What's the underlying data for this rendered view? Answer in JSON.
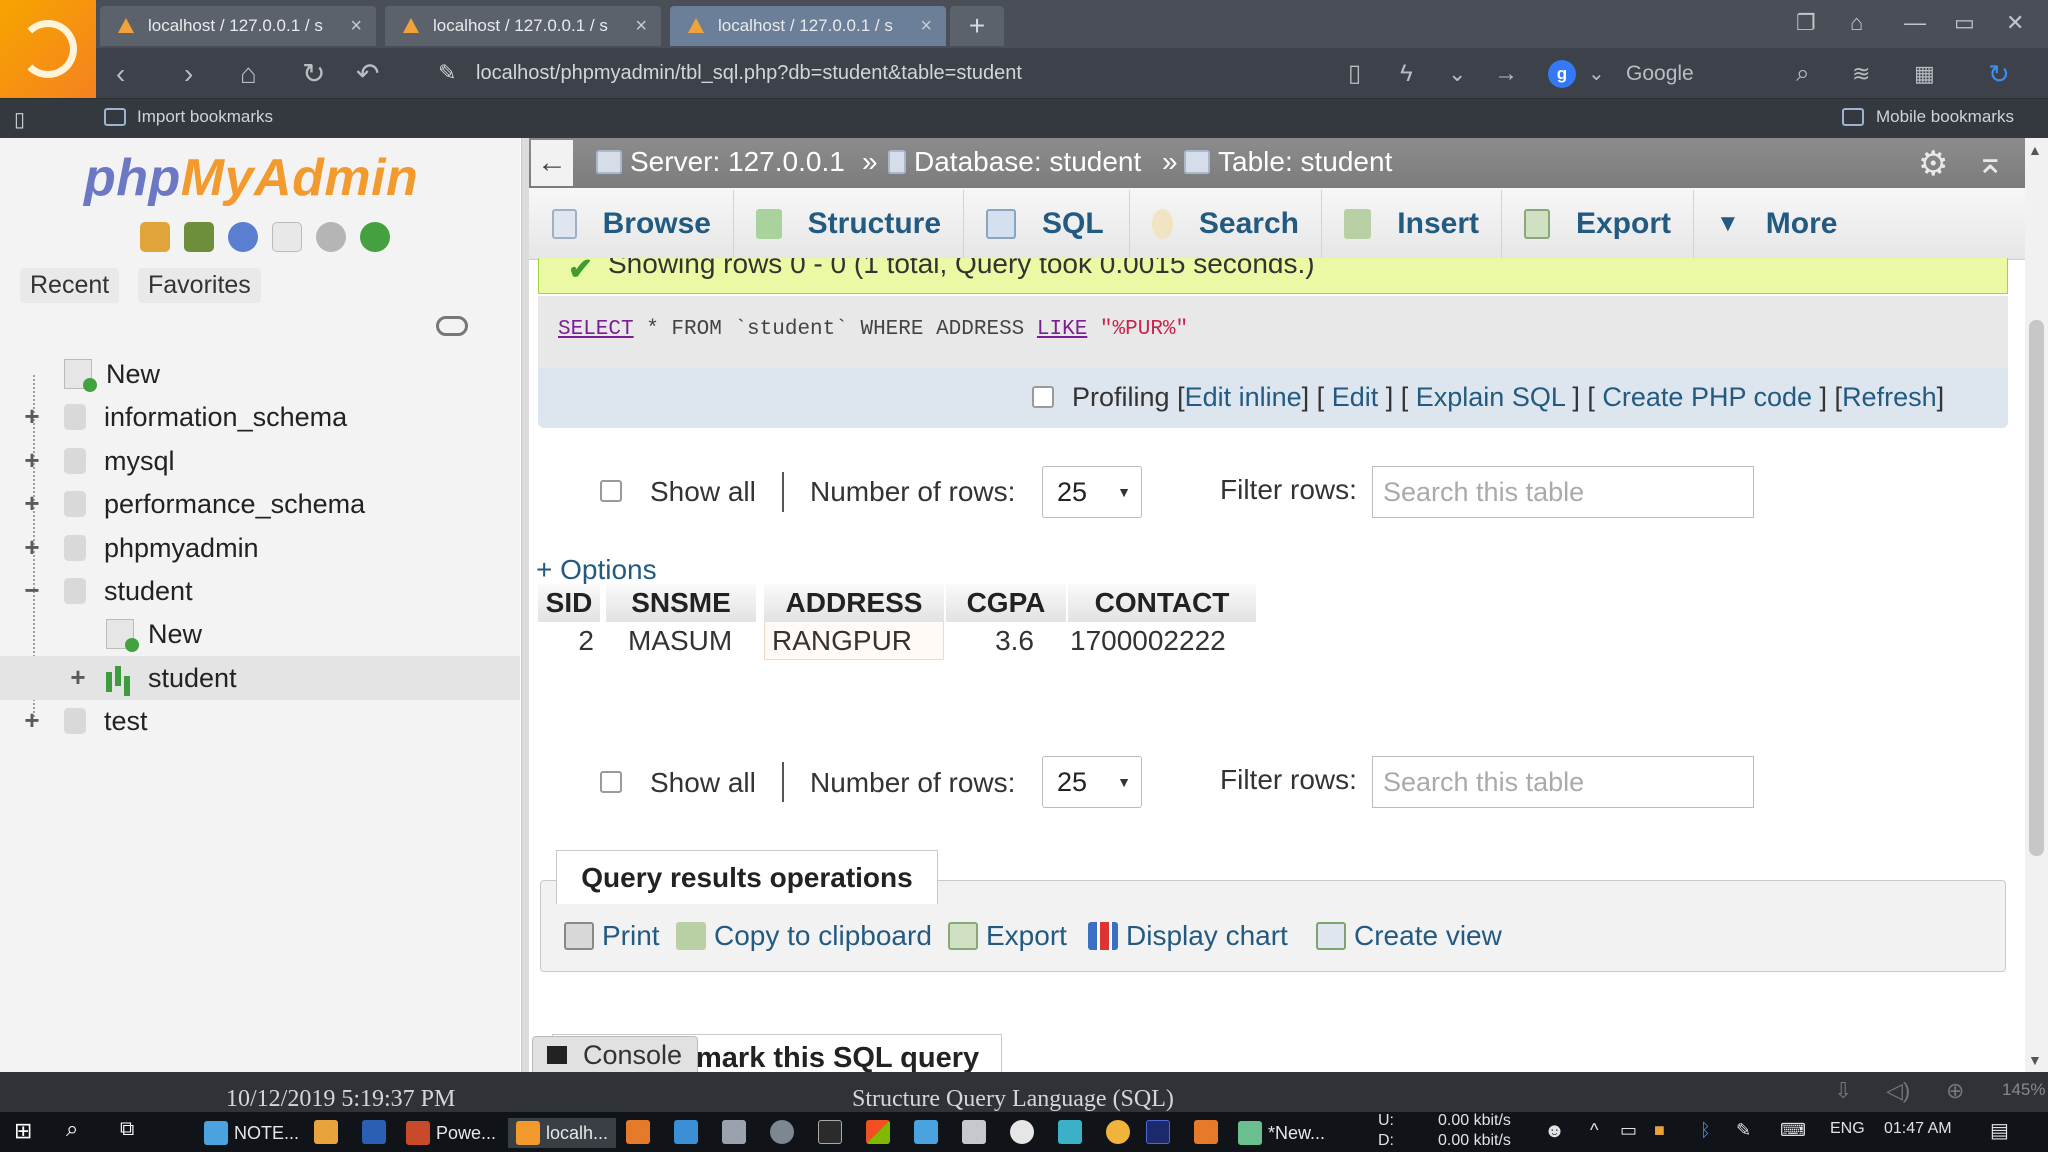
{
  "browser": {
    "tabs": [
      {
        "label": "localhost / 127.0.0.1 / s"
      },
      {
        "label": "localhost / 127.0.0.1 / s"
      },
      {
        "label": "localhost / 127.0.0.1 / s"
      }
    ],
    "url": "localhost/phpmyadmin/tbl_sql.php?db=student&table=student",
    "search_engine": "Google",
    "bookmarks": {
      "import": "Import bookmarks",
      "mobile": "Mobile bookmarks"
    }
  },
  "sidebar": {
    "logo_php": "php",
    "logo_myadmin": "MyAdmin",
    "recent_tab": "Recent",
    "favorites_tab": "Favorites",
    "tree": {
      "new_db": "New",
      "databases": [
        "information_schema",
        "mysql",
        "performance_schema",
        "phpmyadmin",
        "student",
        "test"
      ],
      "student_children": {
        "new_table": "New",
        "table": "student"
      }
    }
  },
  "breadcrumb": {
    "server": "Server: 127.0.0.1",
    "sep1": "»",
    "database": "Database: student",
    "sep2": "»",
    "table": "Table: student"
  },
  "menu_tabs": {
    "browse": "Browse",
    "structure": "Structure",
    "sql": "SQL",
    "search": "Search",
    "insert": "Insert",
    "export": "Export",
    "more": "More"
  },
  "result_message": "Showing rows 0 - 0 (1 total, Query took 0.0015 seconds.)",
  "sql_query": {
    "select": "SELECT",
    "part1": " * FROM `student` WHERE ADDRESS ",
    "like": "LIKE",
    "space": " ",
    "pattern": "\"%PUR%\""
  },
  "profiling": {
    "label": "Profiling",
    "edit_inline": "Edit inline",
    "edit": "Edit",
    "explain": "Explain SQL",
    "create_php": "Create PHP code",
    "refresh": "Refresh",
    "open": "[",
    "close": "]",
    "mid": "] ["
  },
  "navigation": {
    "show_all": "Show all",
    "rows_label": "Number of rows:",
    "rows_value": "25",
    "filter_label": "Filter rows:",
    "filter_placeholder": "Search this table"
  },
  "options_link": "+ Options",
  "results_table": {
    "columns": [
      "SID",
      "SNSME",
      "ADDRESS",
      "CGPA",
      "CONTACT"
    ],
    "rows": [
      [
        "2",
        "MASUM",
        "RANGPUR",
        "3.6",
        "1700002222"
      ]
    ]
  },
  "query_ops": {
    "title": "Query results operations",
    "print": "Print",
    "copy": "Copy to clipboard",
    "export": "Export",
    "display_chart": "Display chart",
    "create_view": "Create view"
  },
  "bookmark_heading": "mark this SQL query",
  "console": "Console",
  "overlay": {
    "timestamp": "10/12/2019 5:19:37 PM",
    "caption": "Structure Query Language (SQL)",
    "zoom": "145%"
  },
  "taskbar": {
    "items": [
      "NOTE...",
      "Powe...",
      "localh...",
      "*New..."
    ],
    "net_up_label": "U:",
    "net_down_label": "D:",
    "net_up": "0.00 kbit/s",
    "net_down": "0.00 kbit/s",
    "lang": "ENG",
    "time": "01:47 AM"
  },
  "colors": {
    "link": "#235a81",
    "success_bg": "#ebf8a4",
    "logo_php": "#6c78c4",
    "logo_myadmin": "#f29a2e"
  }
}
